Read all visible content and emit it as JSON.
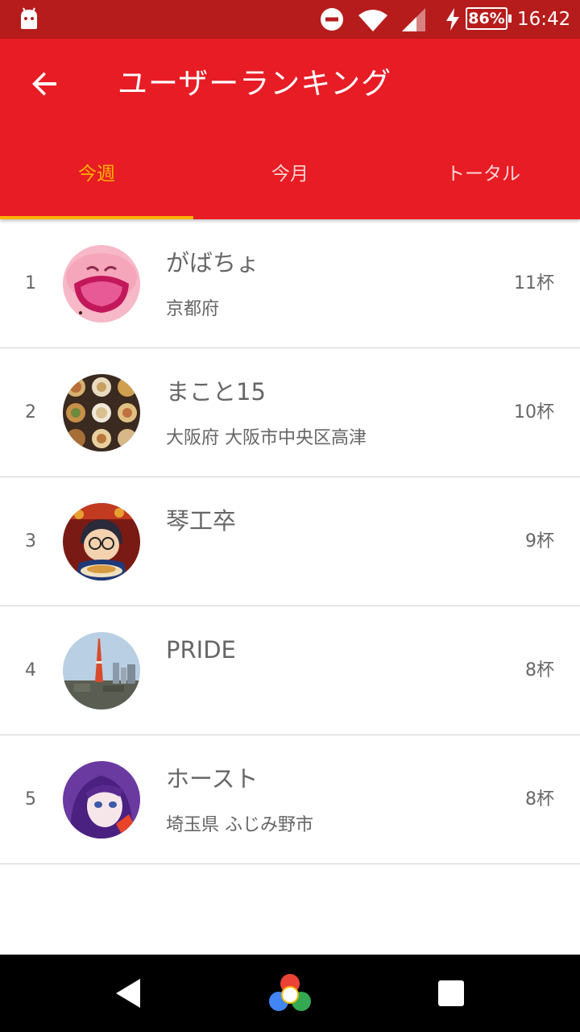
{
  "status_bar": {
    "battery": "86%",
    "time": "16:42"
  },
  "app_bar": {
    "title": "ユーザーランキング"
  },
  "tabs": [
    {
      "label": "今週",
      "active": true
    },
    {
      "label": "今月",
      "active": false
    },
    {
      "label": "トータル",
      "active": false
    }
  ],
  "colors": {
    "app_bar": "#e81c24",
    "status_bar": "#b71c1c",
    "accent": "#ffb300"
  },
  "rankings": [
    {
      "rank": "1",
      "name": "がばちょ",
      "location": "京都府",
      "count": "11杯"
    },
    {
      "rank": "2",
      "name": "まこと15",
      "location": "大阪府 大阪市中央区高津",
      "count": "10杯"
    },
    {
      "rank": "3",
      "name": "琴工卒",
      "location": "",
      "count": "9杯"
    },
    {
      "rank": "4",
      "name": "PRIDE",
      "location": "",
      "count": "8杯"
    },
    {
      "rank": "5",
      "name": "ホースト",
      "location": "埼玉県 ふじみ野市",
      "count": "8杯"
    }
  ]
}
